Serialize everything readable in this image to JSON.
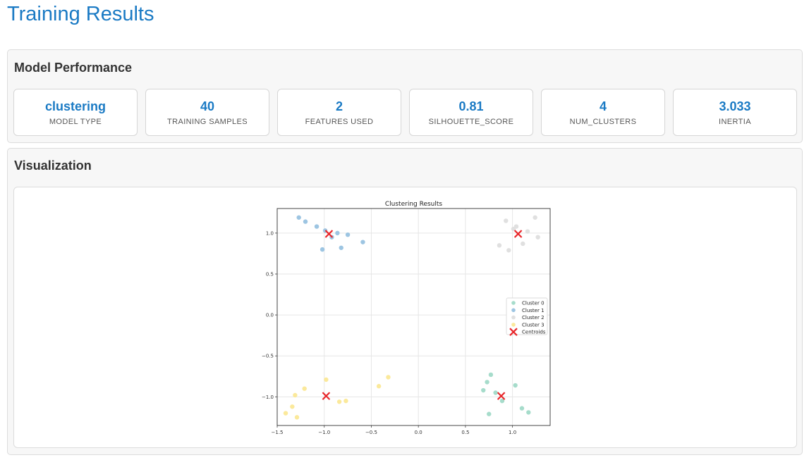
{
  "page": {
    "title": "Training Results"
  },
  "performance": {
    "title": "Model Performance",
    "metrics": [
      {
        "value": "clustering",
        "label": "MODEL TYPE"
      },
      {
        "value": "40",
        "label": "TRAINING SAMPLES"
      },
      {
        "value": "2",
        "label": "FEATURES USED"
      },
      {
        "value": "0.81",
        "label": "SILHOUETTE_SCORE"
      },
      {
        "value": "4",
        "label": "NUM_CLUSTERS"
      },
      {
        "value": "3.033",
        "label": "INERTIA"
      }
    ]
  },
  "visualization": {
    "title": "Visualization"
  },
  "chart_data": {
    "type": "scatter",
    "title": "Clustering Results",
    "xlabel": "",
    "ylabel": "",
    "xlim": [
      -1.5,
      1.4
    ],
    "ylim": [
      -1.35,
      1.3
    ],
    "xticks": [
      "−1.5",
      "−1.0",
      "−0.5",
      "0.0",
      "0.5",
      "1.0"
    ],
    "yticks": [
      "−1.0",
      "−0.5",
      "0.0",
      "0.5",
      "1.0"
    ],
    "grid": true,
    "legend_position": "right",
    "series": [
      {
        "name": "Cluster 0",
        "color": "#a6dccb",
        "points": [
          [
            0.77,
            -0.73
          ],
          [
            0.73,
            -0.82
          ],
          [
            0.69,
            -0.92
          ],
          [
            0.82,
            -0.95
          ],
          [
            0.89,
            -1.05
          ],
          [
            1.03,
            -0.86
          ],
          [
            0.75,
            -1.21
          ],
          [
            1.1,
            -1.14
          ],
          [
            1.17,
            -1.19
          ]
        ]
      },
      {
        "name": "Cluster 1",
        "color": "#9dc5e2",
        "points": [
          [
            -1.27,
            1.19
          ],
          [
            -1.2,
            1.14
          ],
          [
            -1.08,
            1.08
          ],
          [
            -0.99,
            1.03
          ],
          [
            -0.92,
            0.95
          ],
          [
            -0.86,
            1.0
          ],
          [
            -0.75,
            0.98
          ],
          [
            -0.82,
            0.82
          ],
          [
            -1.02,
            0.8
          ],
          [
            -0.59,
            0.89
          ]
        ]
      },
      {
        "name": "Cluster 2",
        "color": "#e0e0e0",
        "points": [
          [
            0.93,
            1.15
          ],
          [
            1.01,
            1.05
          ],
          [
            1.04,
            1.08
          ],
          [
            1.16,
            1.02
          ],
          [
            1.24,
            1.19
          ],
          [
            1.11,
            0.87
          ],
          [
            0.86,
            0.85
          ],
          [
            0.96,
            0.79
          ],
          [
            1.27,
            0.95
          ]
        ]
      },
      {
        "name": "Cluster 3",
        "color": "#fbe99b",
        "points": [
          [
            -1.21,
            -0.9
          ],
          [
            -1.31,
            -0.98
          ],
          [
            -0.98,
            -0.79
          ],
          [
            -0.32,
            -0.76
          ],
          [
            -0.42,
            -0.87
          ],
          [
            -0.77,
            -1.05
          ],
          [
            -0.84,
            -1.06
          ],
          [
            -1.34,
            -1.12
          ],
          [
            -1.41,
            -1.2
          ],
          [
            -1.29,
            -1.25
          ]
        ]
      }
    ],
    "centroids": {
      "name": "Centroids",
      "color": "#e8262a",
      "points": [
        [
          -0.95,
          0.99
        ],
        [
          1.06,
          0.99
        ],
        [
          -0.98,
          -0.99
        ],
        [
          0.88,
          -0.99
        ]
      ]
    }
  }
}
